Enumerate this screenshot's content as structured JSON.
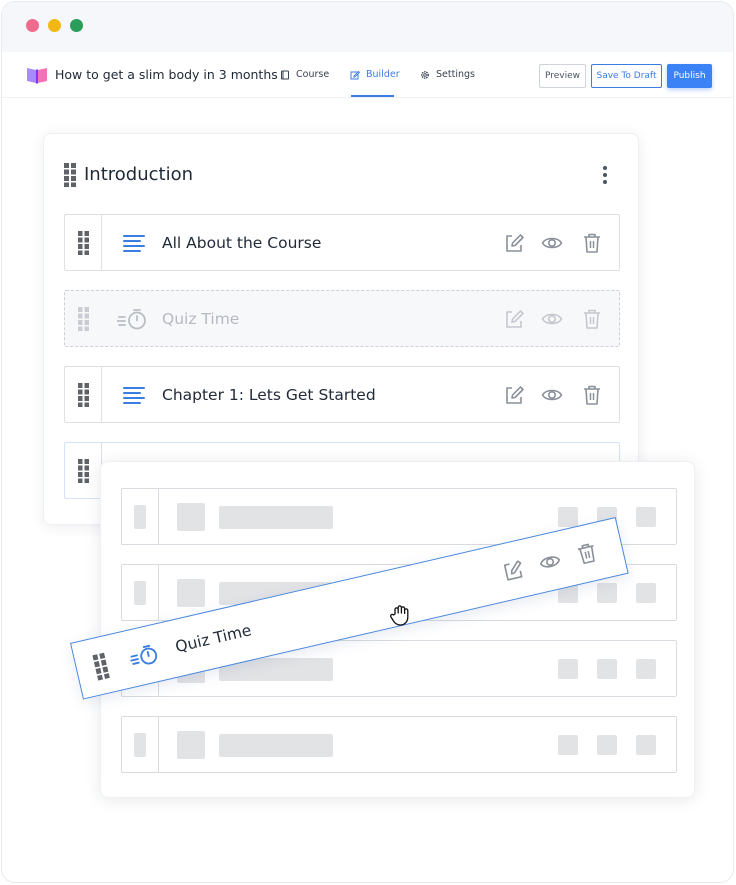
{
  "window": {
    "traffic_lights": [
      "#ef6b8d",
      "#f3b714",
      "#2a9d5a"
    ]
  },
  "topbar": {
    "course_title": "How to get a slim body in 3 months",
    "tabs": [
      {
        "label": "Course",
        "icon": "book-icon",
        "active": false
      },
      {
        "label": "Builder",
        "icon": "edit-icon",
        "active": true
      },
      {
        "label": "Settings",
        "icon": "gear-icon",
        "active": false
      }
    ],
    "buttons": {
      "preview": "Preview",
      "save_draft": "Save To Draft",
      "publish": "Publish"
    },
    "accent": "#3b7de0"
  },
  "section": {
    "title": "Introduction",
    "items": [
      {
        "label": "All About the Course",
        "type": "lesson",
        "icon": "text-lines-icon",
        "state": "normal"
      },
      {
        "label": "Quiz Time",
        "type": "quiz",
        "icon": "stopwatch-icon",
        "state": "drop-placeholder"
      },
      {
        "label": "Chapter 1: Lets Get Started",
        "type": "lesson",
        "icon": "text-lines-icon",
        "state": "normal"
      },
      {
        "label": "",
        "type": "unknown",
        "state": "partially-hidden"
      }
    ]
  },
  "dragging_item": {
    "label": "Quiz Time",
    "icon": "stopwatch-icon",
    "state": "dragging"
  },
  "placeholder_rows": 4
}
